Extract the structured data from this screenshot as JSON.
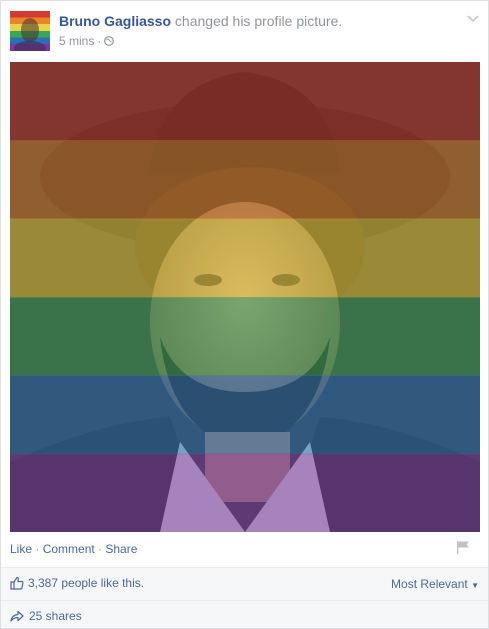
{
  "post": {
    "author": "Bruno Gagliasso",
    "action": "changed his profile picture.",
    "time": "5 mins",
    "time_separator": "·",
    "privacy_icon": "globe-icon",
    "menu_icon": "chevron-down-icon"
  },
  "photo": {
    "overlay_colors": [
      "#c0392b",
      "#d9822b",
      "#e8cf3c",
      "#3aa65b",
      "#2a77b8",
      "#7b3fa8"
    ],
    "overlay_opacity": 0.55
  },
  "actions": {
    "like": "Like",
    "comment": "Comment",
    "share": "Share",
    "separator": " · ",
    "flag_icon": "flag-icon"
  },
  "stats": {
    "likes_text": "3,387 people like this.",
    "sort_label": "Most Relevant",
    "shares_text": "25 shares"
  },
  "colors": {
    "link": "#4b67a1",
    "author": "#365899",
    "muted": "#90949c"
  }
}
